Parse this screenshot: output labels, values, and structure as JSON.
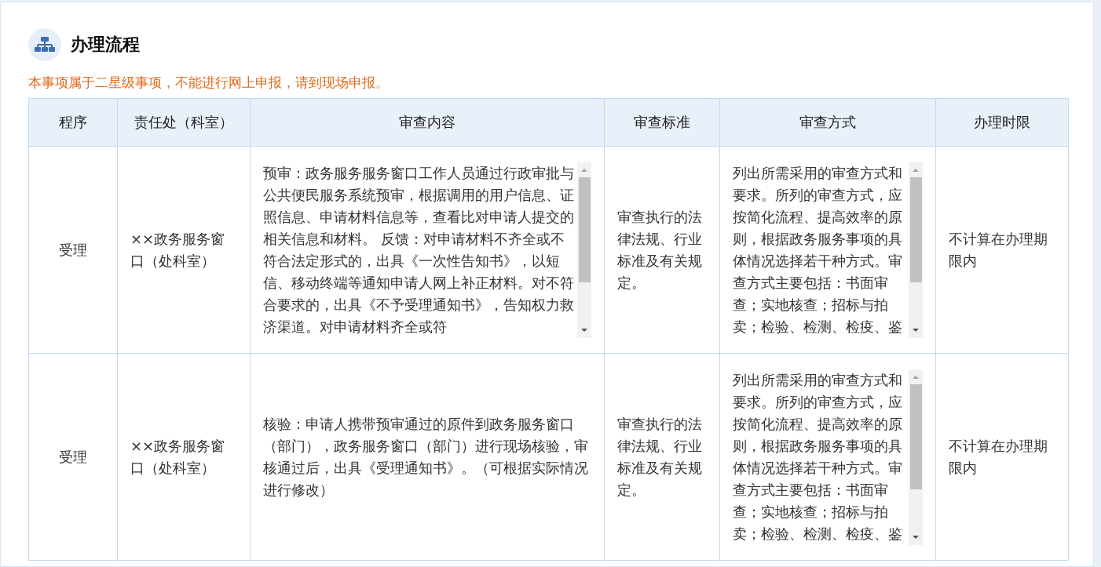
{
  "section": {
    "title": "办理流程",
    "notice": "本事项属于二星级事项，不能进行网上申报，请到现场申报。"
  },
  "table": {
    "columns": [
      "程序",
      "责任处（科室）",
      "审查内容",
      "审查标准",
      "审查方式",
      "办理时限"
    ],
    "rows": [
      {
        "cells": [
          {
            "kind": "text",
            "text": "受理"
          },
          {
            "kind": "text",
            "text": "××政务服务窗口（处科室）"
          },
          {
            "kind": "scroll",
            "text": "预审：政务服务服务窗口工作人员通过行政审批与公共便民服务系统预审，根据调用的用户信息、证照信息、申请材料信息等，查看比对申请人提交的相关信息和材料。 反馈：对申请材料不齐全或不符合法定形式的，出具《一次性告知书》，以短信、移动终端等通知申请人网上补正材料。对不符合要求的，出具《不予受理通知书》，告知权力救济渠道。对申请材料齐全或符"
          },
          {
            "kind": "text",
            "text": "审查执行的法律法规、行业标准及有关规定。"
          },
          {
            "kind": "scroll",
            "text": "列出所需采用的审查方式和要求。所列的审查方式，应按简化流程、提高效率的原则，根据政务服务事项的具体情况选择若干种方式。审查方式主要包括：书面审查；实地核查；招标与拍卖；检验、检测、检疫、鉴"
          },
          {
            "kind": "text",
            "text": "不计算在办理期限内"
          }
        ]
      },
      {
        "cells": [
          {
            "kind": "text",
            "text": "受理"
          },
          {
            "kind": "text",
            "text": "××政务服务窗口（处科室）"
          },
          {
            "kind": "text",
            "text": "核验：申请人携带预审通过的原件到政务服务窗口（部门），政务服务窗口（部门）进行现场核验，审核通过后，出具《受理通知书》。（可根据实际情况进行修改）"
          },
          {
            "kind": "text",
            "text": "审查执行的法律法规、行业标准及有关规定。"
          },
          {
            "kind": "scroll",
            "text": "列出所需采用的审查方式和要求。所列的审查方式，应按简化流程、提高效率的原则，根据政务服务事项的具体情况选择若干种方式。审查方式主要包括：书面审查；实地核查；招标与拍卖；检验、检测、检疫、鉴"
          },
          {
            "kind": "text",
            "text": "不计算在办理期限内"
          }
        ]
      }
    ]
  }
}
